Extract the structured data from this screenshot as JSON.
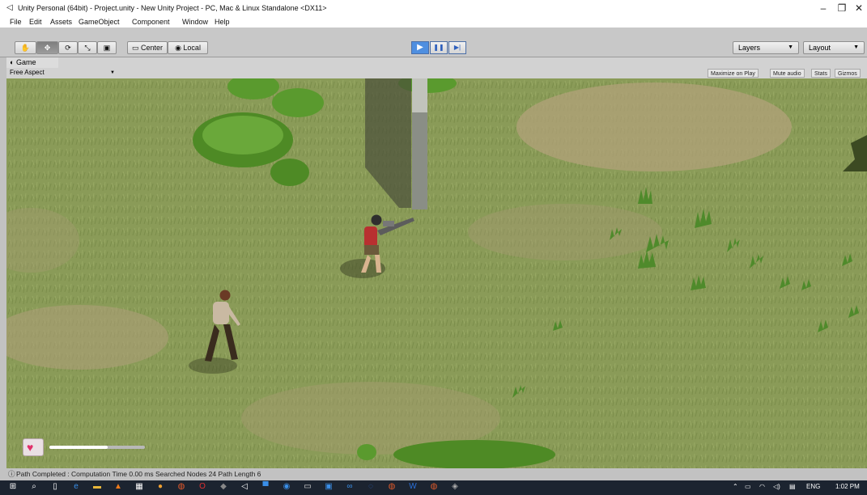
{
  "window": {
    "title": "Unity Personal (64bit) - Project.unity - New Unity Project - PC, Mac & Linux Standalone <DX11>",
    "controls": [
      "–",
      "❐",
      "✕"
    ]
  },
  "menu": [
    "File",
    "Edit",
    "Assets",
    "GameObject",
    "Component",
    "Window",
    "Help"
  ],
  "toolbar": {
    "tools": [
      {
        "name": "hand-tool-button",
        "glyph": "✋"
      },
      {
        "name": "move-tool-button",
        "glyph": "✥"
      },
      {
        "name": "rotate-tool-button",
        "glyph": "⟳"
      },
      {
        "name": "scale-tool-button",
        "glyph": "⤡"
      },
      {
        "name": "rect-tool-button",
        "glyph": "▣"
      }
    ],
    "pivot_label": "Center",
    "space_label": "Local",
    "play_glyph": "▶",
    "pause_glyph": "❚❚",
    "step_glyph": "▶|",
    "layers_label": "Layers",
    "layout_label": "Layout"
  },
  "game_view": {
    "tab_label": "Game",
    "aspect_label": "Free Aspect",
    "toggles": [
      "Maximize on Play",
      "Mute audio",
      "Stats",
      "Gizmos"
    ]
  },
  "hud": {
    "health_fraction": 0.61,
    "heart_color": "#e0306a"
  },
  "status": {
    "message": "Path Completed : Computation Time 0.00 ms Searched Nodes 24 Path Length 6"
  },
  "taskbar": {
    "language": "ENG",
    "time": "1:02 PM"
  },
  "colors": {
    "play_active": "#4f8fe0",
    "grass": "#879954"
  }
}
